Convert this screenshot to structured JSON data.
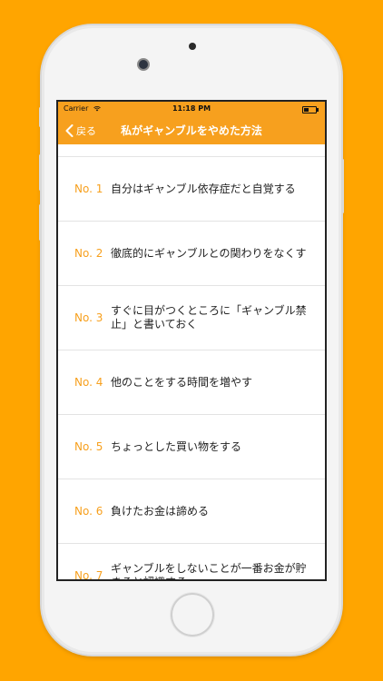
{
  "status_bar": {
    "carrier": "Carrier",
    "time": "11:18 PM",
    "wifi_icon": "wifi-icon",
    "battery_icon": "battery-icon"
  },
  "nav": {
    "back_label": "戻る",
    "back_icon": "chevron-left-icon",
    "title": "私がギャンブルをやめた方法"
  },
  "items": [
    {
      "num": "No. 1",
      "text": "自分はギャンブル依存症だと自覚する"
    },
    {
      "num": "No. 2",
      "text": "徹底的にギャンブルとの関わりをなくす"
    },
    {
      "num": "No. 3",
      "text": "すぐに目がつくところに「ギャンブル禁止」と書いておく"
    },
    {
      "num": "No. 4",
      "text": "他のことをする時間を増やす"
    },
    {
      "num": "No. 5",
      "text": "ちょっとした買い物をする"
    },
    {
      "num": "No. 6",
      "text": "負けたお金は諦める"
    },
    {
      "num": "No. 7",
      "text": "ギャンブルをしないことが一番お金が貯まると認識する"
    }
  ],
  "colors": {
    "background": "#FFA500",
    "accent": "#F7A01E",
    "number_text": "#F7A01E"
  }
}
